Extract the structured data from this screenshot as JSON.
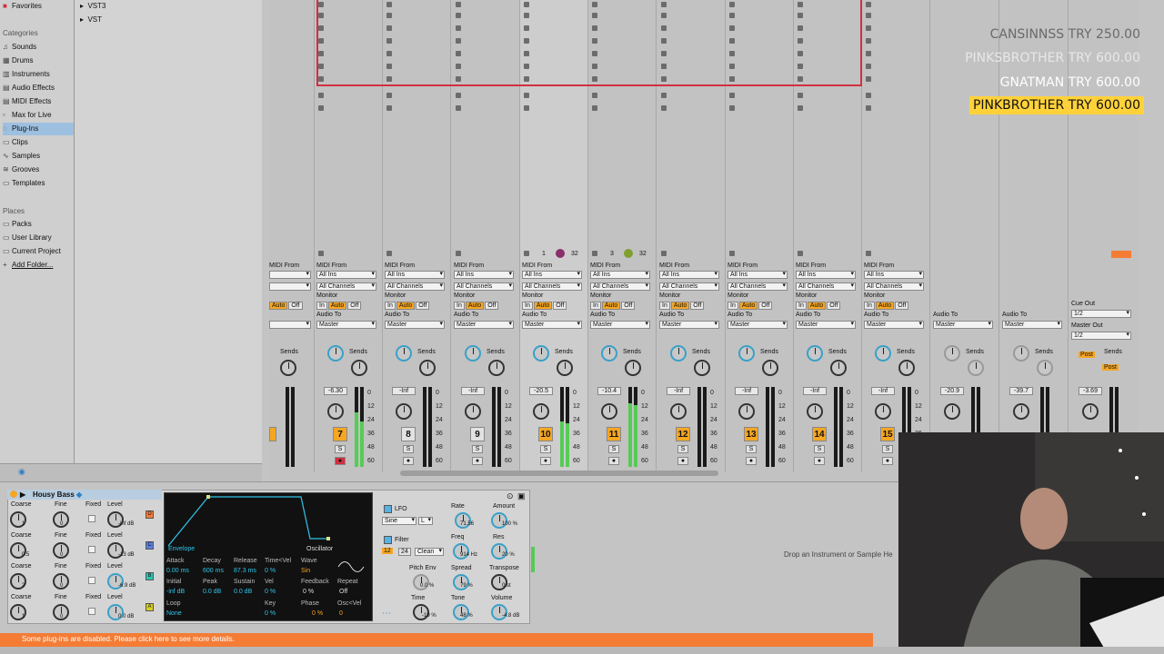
{
  "browser": {
    "favorites": "Favorites",
    "categories_head": "Categories",
    "categories": [
      "Sounds",
      "Drums",
      "Instruments",
      "Audio Effects",
      "MIDI Effects",
      "Max for Live",
      "Plug-Ins",
      "Clips",
      "Samples",
      "Grooves",
      "Templates"
    ],
    "selected_category": "Plug-Ins",
    "places_head": "Places",
    "places": [
      "Packs",
      "User Library",
      "Current Project",
      "Add Folder..."
    ],
    "tree": [
      "VST3",
      "VST"
    ]
  },
  "overlay": {
    "line1": "CANSINNSS  TRY 250.00",
    "line2": "PINKSBROTHER  TRY 600.00",
    "line3": "GNATMAN  TRY 600.00",
    "line4": "PINKBROTHER  TRY 600.00"
  },
  "mixer": {
    "midi_from": "MIDI From",
    "all_ins": "All Ins",
    "all_channels": "All Channels",
    "monitor": "Monitor",
    "mon_in": "In",
    "mon_auto": "Auto",
    "mon_off": "Off",
    "audio_to": "Audio To",
    "master": "Master",
    "sends": "Sends",
    "cue_out": "Cue Out",
    "cue_val": "1/2",
    "master_out": "Master Out",
    "master_val": "1/2",
    "post": "Post",
    "scale": [
      "0",
      "12",
      "24",
      "36",
      "48",
      "60"
    ],
    "clip_counts": [
      "1",
      "32",
      "3",
      "32"
    ],
    "tracks": [
      {
        "num": "7",
        "vol": "-6.30"
      },
      {
        "num": "8",
        "vol": "-Inf"
      },
      {
        "num": "9",
        "vol": "-Inf"
      },
      {
        "num": "10",
        "vol": "-20.5"
      },
      {
        "num": "11",
        "vol": "-10.4"
      },
      {
        "num": "12",
        "vol": "-Inf"
      },
      {
        "num": "13",
        "vol": "-Inf"
      },
      {
        "num": "14",
        "vol": "-Inf"
      },
      {
        "num": "15",
        "vol": "-Inf"
      }
    ],
    "returns": [
      {
        "vol": "-20.9"
      },
      {
        "vol": "-39.7"
      }
    ],
    "master_vol": "-3.69",
    "solo": "S"
  },
  "device": {
    "name": "Housy Bass",
    "osc_labels": {
      "coarse": "Coarse",
      "fine": "Fine",
      "fixed": "Fixed",
      "level": "Level"
    },
    "osc_levels": [
      "-inf dB",
      "-13 dB",
      "-6.9 dB",
      "0.0 dB"
    ],
    "osc_coarse": [
      "1",
      "0.5",
      "2",
      "1"
    ],
    "osc_fine": [
      "0",
      "0",
      "0",
      "0"
    ],
    "osc_letters": [
      "D",
      "C",
      "B",
      "A"
    ],
    "envelope": "Envelope",
    "oscillator": "Oscillator",
    "env_labels": [
      "Attack",
      "Decay",
      "Release",
      "Time<Vel"
    ],
    "env_values": [
      "0.00 ms",
      "600 ms",
      "87.3 ms",
      "0 %"
    ],
    "env_labels2": [
      "Initial",
      "Peak",
      "Sustain",
      "Vel"
    ],
    "env_values2": [
      "-inf dB",
      "0.0 dB",
      "0.0 dB",
      "0 %"
    ],
    "wave_label": "Wave",
    "wave_val": "Sin",
    "feedback": "Feedback",
    "repeat": "Repeat",
    "feedback_val": "0 %",
    "repeat_val": "Off",
    "loop": "Loop",
    "loop_val": "None",
    "key": "Key",
    "key_val": "0 %",
    "phase": "Phase",
    "phase_val": "0 %",
    "osc_vel": "Osc<Vel",
    "osc_vel_val": "0",
    "lfo": "LFO",
    "lfo_wave": "Sine",
    "lfo_mode": "L",
    "rate": "Rate",
    "rate_val": "71.56",
    "amount": "Amount",
    "amount_val": "100 %",
    "filter": "Filter",
    "filter_slope_a": "12",
    "filter_slope_b": "24",
    "filter_mode": "Clean",
    "freq": "Freq",
    "freq_val": "914 Hz",
    "res": "Res",
    "res_val": "20 %",
    "pitch_env": "Pitch Env",
    "pitch_env_val": "0.0 %",
    "spread": "Spread",
    "spread_val": "79 %",
    "transpose": "Transpose",
    "transpose_val": "0 st",
    "time": "Time",
    "time_val": "-19 %",
    "tone": "Tone",
    "tone_val": "48 %",
    "volume": "Volume",
    "volume_val": "-4.8 dB"
  },
  "drop_message": "Drop an Instrument or Sample He",
  "status_message": "Some plug-ins are disabled. Please click here to see more details.",
  "colors": {
    "orange": "#f5a623",
    "status": "#f47c35",
    "env_blue": "#2fc5ea",
    "clip_red": "#d03040"
  }
}
